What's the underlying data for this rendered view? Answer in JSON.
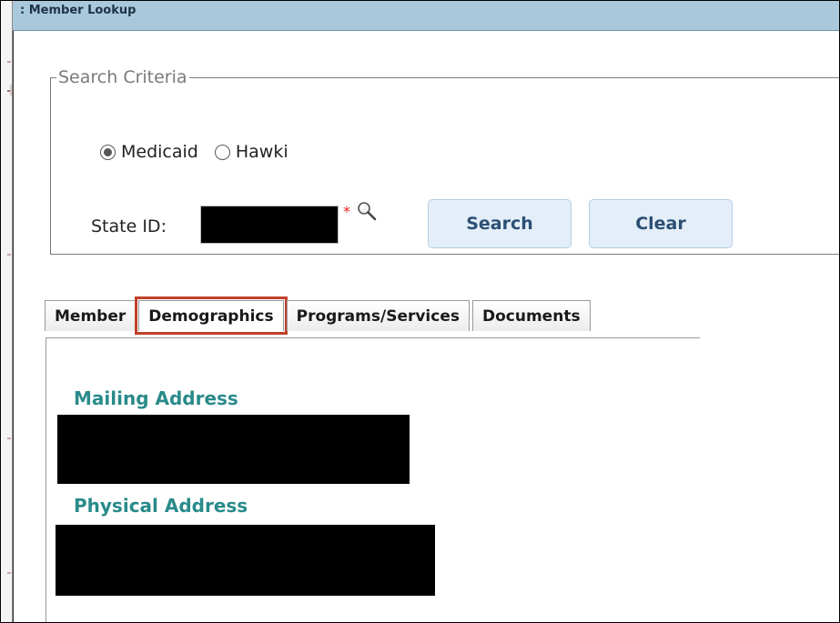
{
  "window": {
    "title": ": Member Lookup"
  },
  "search_criteria": {
    "legend": "Search Criteria",
    "programs": [
      {
        "label": "Medicaid",
        "checked": true
      },
      {
        "label": "Hawki",
        "checked": false
      }
    ],
    "state_id_label": "State ID:",
    "state_id_value_redacted": true,
    "required_marker": "*",
    "lookup_icon": "magnifier-icon",
    "search_button": "Search",
    "clear_button": "Clear"
  },
  "tabs": [
    {
      "label": "Member",
      "selected": false
    },
    {
      "label": "Demographics",
      "selected": true
    },
    {
      "label": "Programs/Services",
      "selected": false
    },
    {
      "label": "Documents",
      "selected": false
    }
  ],
  "demographics": {
    "mailing_address_heading": "Mailing Address",
    "mailing_address_redacted": true,
    "physical_address_heading": "Physical Address",
    "physical_address_redacted": true
  },
  "colors": {
    "titlebar": "#aac8dc",
    "heading_teal": "#2a8a8a",
    "button_text": "#2c4f74",
    "button_bg": "#e3eef8",
    "highlight_border": "#c0412a",
    "required_red": "#e2231a"
  }
}
